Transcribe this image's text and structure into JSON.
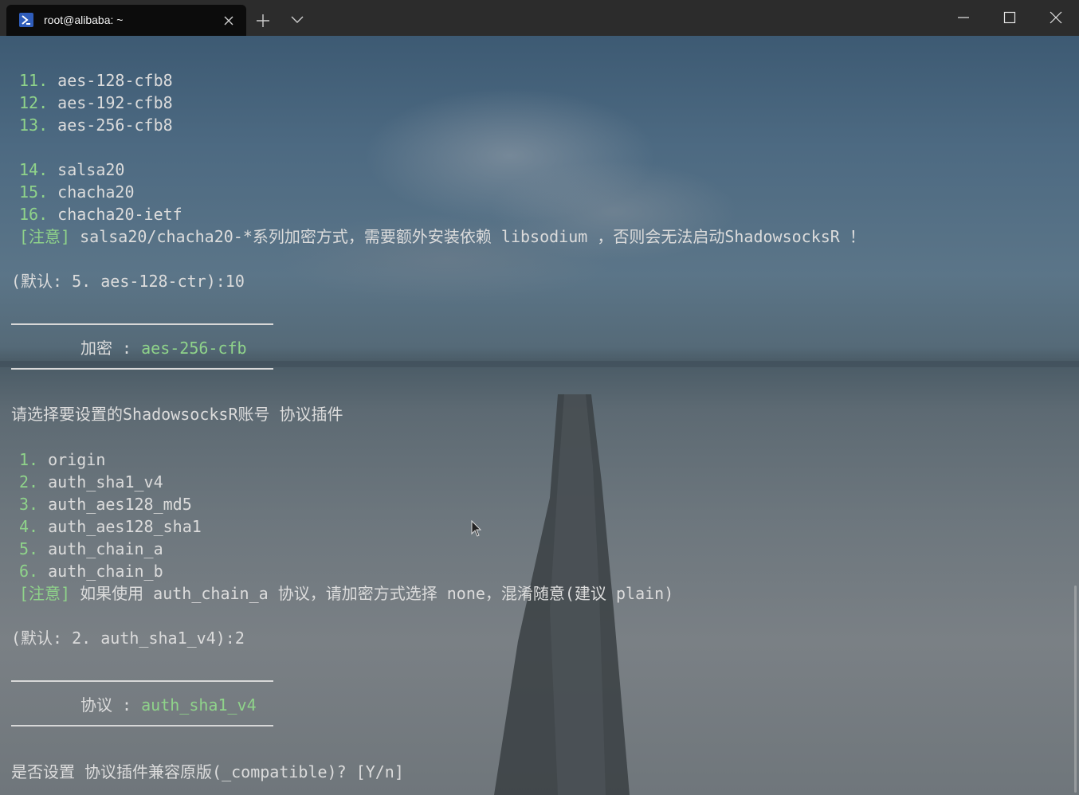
{
  "window": {
    "tab_title": "root@alibaba: ~",
    "icons": [
      "powershell-icon",
      "close-icon",
      "plus-icon",
      "chevron-down-icon",
      "minimize-icon",
      "maximize-icon",
      "window-close-icon"
    ]
  },
  "terminal": {
    "colors": {
      "text": "#dcdcdc",
      "accent": "#8fd38a"
    },
    "lines": [
      {
        "num": "11.",
        "text": "aes-128-cfb8"
      },
      {
        "num": "12.",
        "text": "aes-192-cfb8"
      },
      {
        "num": "13.",
        "text": "aes-256-cfb8"
      },
      {
        "num": "14.",
        "text": "salsa20"
      },
      {
        "num": "15.",
        "text": "chacha20"
      },
      {
        "num": "16.",
        "text": "chacha20-ietf"
      },
      {
        "tag": "[注意]",
        "text": "salsa20/chacha20-*系列加密方式，需要额外安装依赖 libsodium ，否则会无法启动ShadowsocksR ！"
      },
      {
        "text": "(默认: 5. aes-128-ctr):10"
      },
      {
        "label": "加密 : ",
        "value": "aes-256-cfb"
      },
      {
        "text": "请选择要设置的ShadowsocksR账号 协议插件"
      },
      {
        "num": "1.",
        "text": "origin"
      },
      {
        "num": "2.",
        "text": "auth_sha1_v4"
      },
      {
        "num": "3.",
        "text": "auth_aes128_md5"
      },
      {
        "num": "4.",
        "text": "auth_aes128_sha1"
      },
      {
        "num": "5.",
        "text": "auth_chain_a"
      },
      {
        "num": "6.",
        "text": "auth_chain_b"
      },
      {
        "tag": "[注意]",
        "text": "如果使用 auth_chain_a 协议，请加密方式选择 none，混淆随意(建议 plain)"
      },
      {
        "text": "(默认: 2. auth_sha1_v4):2"
      },
      {
        "label": "协议 : ",
        "value": "auth_sha1_v4"
      },
      {
        "text": "是否设置 协议插件兼容原版(_compatible)? [Y/n]"
      }
    ]
  }
}
